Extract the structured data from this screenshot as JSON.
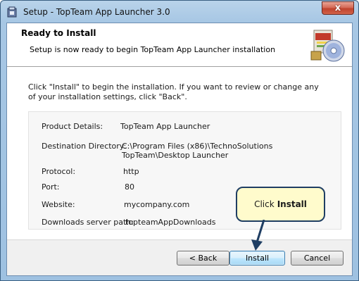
{
  "window": {
    "title": "Setup - TopTeam App Launcher 3.0",
    "close_glyph": "x"
  },
  "header": {
    "title": "Ready to Install",
    "subtitle": "Setup is now ready to begin TopTeam App Launcher installation",
    "art_icon": "setup-box-cd-icon"
  },
  "intro": "Click \"Install\" to begin the installation.  If you want to review or change any of your installation settings, click \"Back\".",
  "details": {
    "product_label": "Product Details:",
    "product_value": "TopTeam App Launcher",
    "dest_label": "Destination Directory:",
    "dest_value": "C:\\Program Files (x86)\\TechnoSolutions TopTeam\\Desktop Launcher",
    "protocol_label": "Protocol:",
    "protocol_value": "http",
    "port_label": "Port:",
    "port_value": "80",
    "website_label": "Website:",
    "website_value": "mycompany.com",
    "downloads_label": "Downloads server path:",
    "downloads_value": "topteamAppDownloads"
  },
  "buttons": {
    "back": "< Back",
    "install": "Install",
    "cancel": "Cancel"
  },
  "callout": {
    "prefix": "Click",
    "action": "Install"
  },
  "colors": {
    "title_bar": "#a7c7e4",
    "close_button": "#c0432d",
    "callout_fill": "#fffbcc",
    "callout_border": "#1f3e63"
  }
}
